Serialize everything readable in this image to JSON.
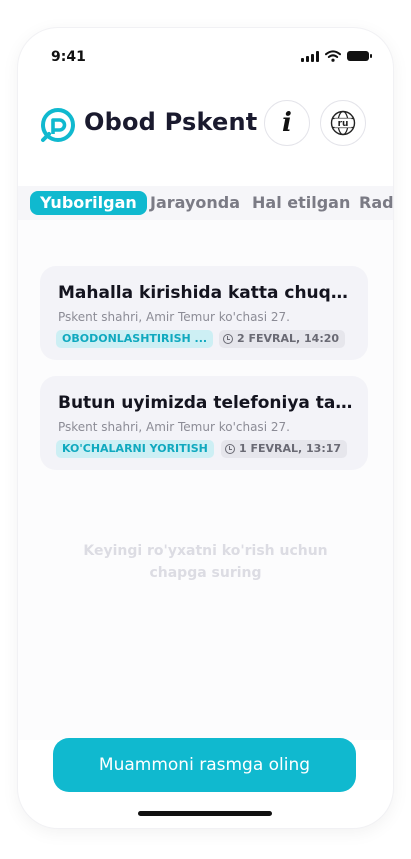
{
  "status_bar": {
    "time": "9:41"
  },
  "header": {
    "app_title": "Obod Pskent",
    "lang_button": "ru"
  },
  "tabs": [
    {
      "label": "Yuborilgan",
      "active": true
    },
    {
      "label": "Jarayonda",
      "active": false
    },
    {
      "label": "Hal etilgan",
      "active": false
    },
    {
      "label": "Rad",
      "active": false
    }
  ],
  "cards": [
    {
      "title": "Mahalla kirishida katta chuqur bor",
      "address": "Pskent shahri, Amir Temur ko'chasi 27.",
      "category": "OBODONLASHTIRISH ...",
      "date": "2 FEVRAL, 14:20"
    },
    {
      "title": "Butun uyimizda telefoniya tarmo...",
      "address": "Pskent shahri, Amir Temur ko'chasi 27.",
      "category": "KO'CHALARNI YORITISH",
      "date": "1 FEVRAL, 13:17"
    }
  ],
  "hint": "Keyingi ro'yxatni ko'rish uchun chapga suring",
  "cta_label": "Muammoni rasmga oling",
  "colors": {
    "accent": "#10b9cf",
    "category_badge_bg": "#cdeff4"
  }
}
